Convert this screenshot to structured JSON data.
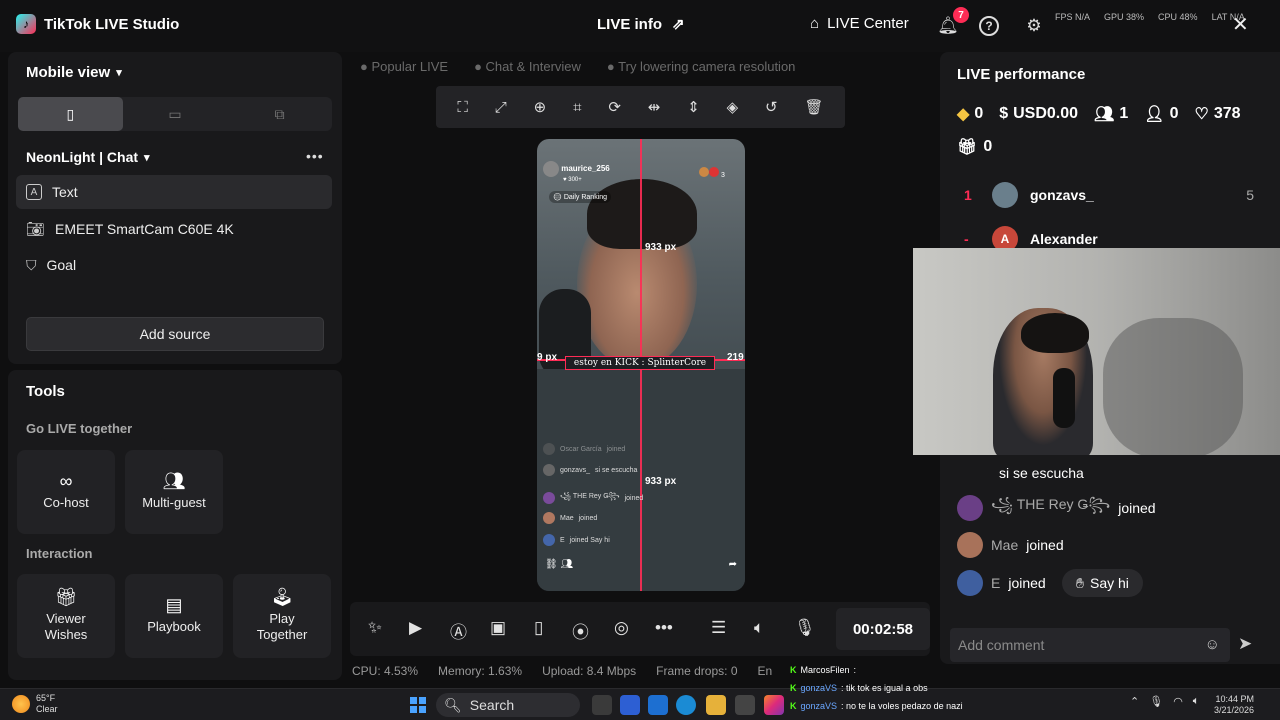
{
  "topbar": {
    "app_title": "TikTok LIVE Studio",
    "live_info": "LIVE info",
    "live_center": "LIVE Center",
    "notif_count": "7",
    "fps": "FPS N/A",
    "gpu": "GPU 38%",
    "cpu": "CPU 48%",
    "lat": "LAT N/A"
  },
  "left": {
    "mobile_view": "Mobile view",
    "scene_name": "NeonLight | Chat",
    "sources": [
      {
        "label": "Text",
        "icon": "text-icon"
      },
      {
        "label": "EMEET SmartCam C60E 4K",
        "icon": "camera-icon"
      },
      {
        "label": "Goal",
        "icon": "goal-icon"
      }
    ],
    "add_source": "Add source",
    "tools_title": "Tools",
    "go_live_together": "Go LIVE together",
    "cohost": "Co-host",
    "multiguest": "Multi-guest",
    "interaction": "Interaction",
    "viewer_wishes": "Viewer Wishes",
    "playbook": "Playbook",
    "play_together": "Play Together"
  },
  "middle": {
    "pills": [
      "Popular LIVE",
      "Chat & Interview",
      "Try lowering camera resolution"
    ],
    "phone": {
      "host": "maurice_256",
      "followers": "300+",
      "viewer_count": "3",
      "daily_ranking": "Daily Ranking",
      "banner": "estoy en KICK : SplinterCore",
      "px_top": "933 px",
      "px_bottom": "933 px",
      "px_left": "9 px",
      "px_right": "219",
      "chat": [
        {
          "name": "Oscar García",
          "text": "joined"
        },
        {
          "name": "gonzavs_",
          "text": "si se escucha"
        },
        {
          "name": "꧁ THE Rey Ǥ꧂",
          "text": "joined"
        },
        {
          "name": "Mae",
          "text": "joined"
        },
        {
          "name": "E",
          "text": "joined  Say hi"
        }
      ]
    },
    "timer": "00:02:58",
    "status": {
      "cpu": "CPU: 4.53%",
      "memory": "Memory: 1.63%",
      "upload": "Upload: 8.4 Mbps",
      "frame_drops": "Frame drops: 0",
      "encoding": "En"
    }
  },
  "right": {
    "title": "LIVE performance",
    "diamonds": "0",
    "usd": "USD0.00",
    "viewers": "1",
    "new_followers": "0",
    "likes": "378",
    "gifts": "0",
    "ranking": [
      {
        "rank": "1",
        "name": "gonzavs_",
        "score": "5",
        "initial": ""
      },
      {
        "rank": "-",
        "name": "Alexander",
        "score": "",
        "initial": "A"
      }
    ],
    "chat": [
      {
        "name": "",
        "text": "si se escucha"
      },
      {
        "name": "꧁ THE Rey Ǥ꧂",
        "text": "joined"
      },
      {
        "name": "Mae",
        "text": "joined"
      },
      {
        "name": "E",
        "text": "joined"
      }
    ],
    "say_hi": "Say hi",
    "comment_placeholder": "Add comment"
  },
  "taskbar": {
    "temp": "65°F",
    "weather": "Clear",
    "search": "Search",
    "kick_lines": [
      {
        "user": "MarcosFilen",
        "text": ":"
      },
      {
        "user": "gonzaVS",
        "text": ": tik tok es igual a obs"
      },
      {
        "user": "gonzaVS",
        "text": ": no te la voles pedazo de nazi"
      }
    ],
    "time": "10:44 PM",
    "date": "3/21/2026"
  },
  "colors": {
    "accent": "#fe2c55",
    "kick_green": "#53fc18"
  }
}
